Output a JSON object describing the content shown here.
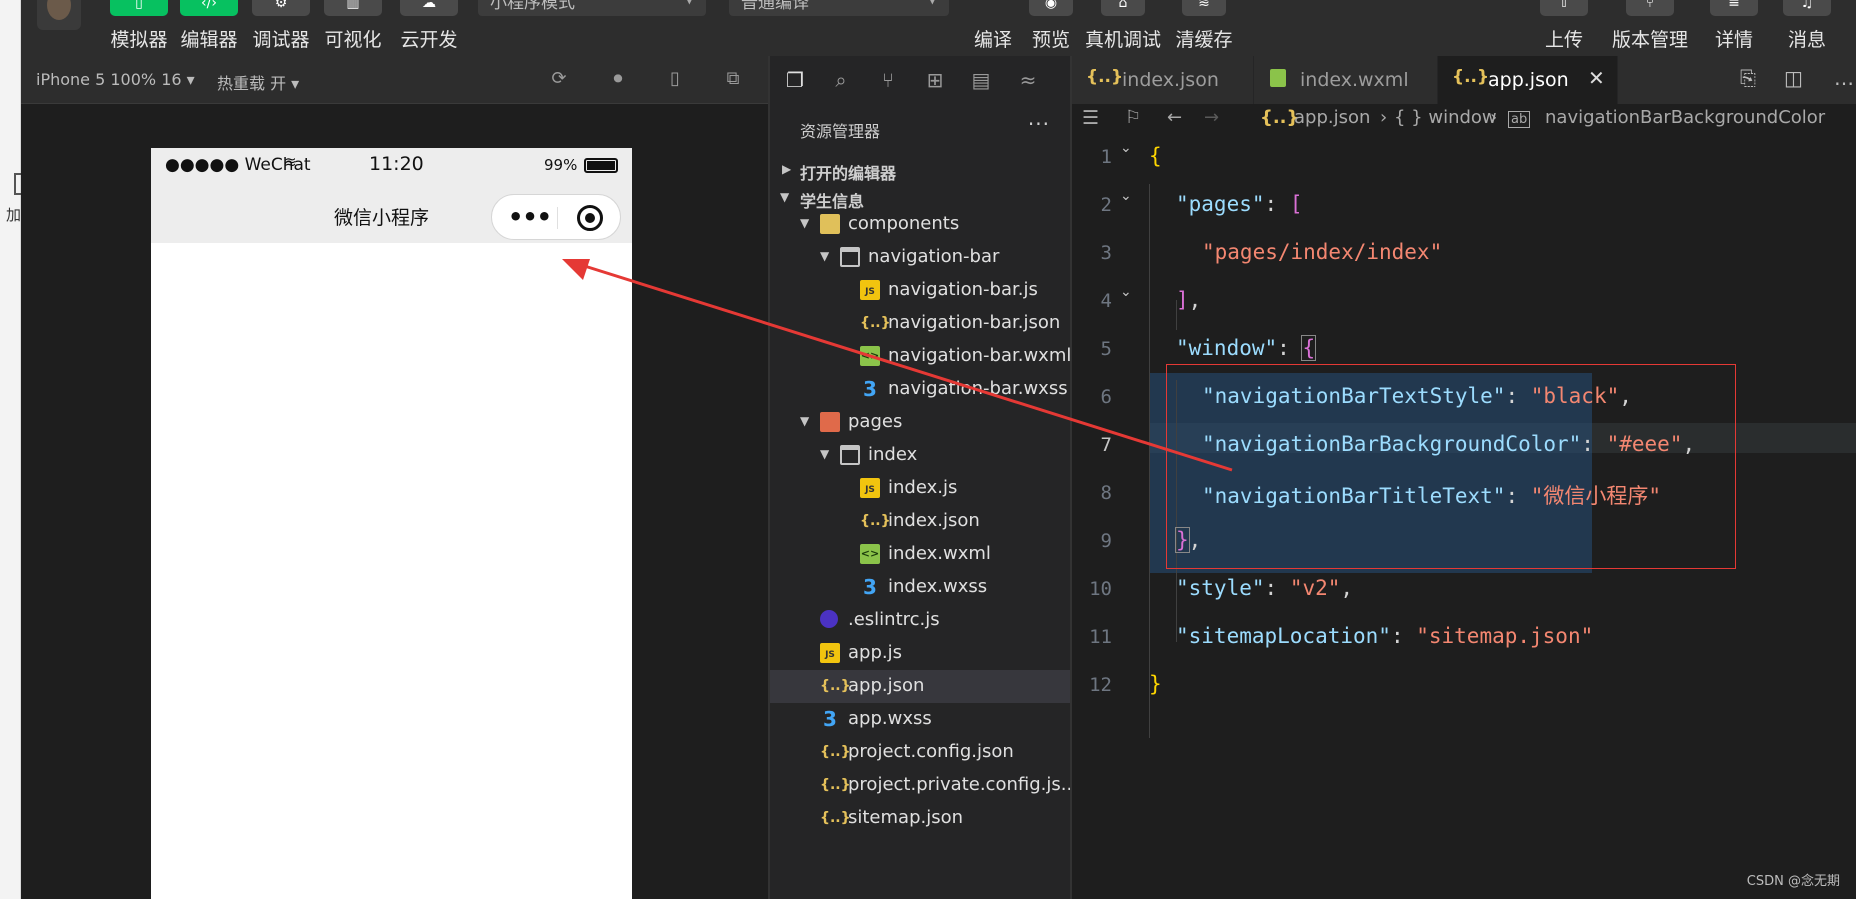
{
  "toolbar": {
    "left_buttons": [
      {
        "label": "模拟器",
        "icon": "phone-icon"
      },
      {
        "label": "编辑器",
        "icon": "code-icon"
      },
      {
        "label": "调试器",
        "icon": "debug-icon"
      },
      {
        "label": "可视化",
        "icon": "layout-icon"
      },
      {
        "label": "云开发",
        "icon": "cloud-icon"
      }
    ],
    "mode_select": "小程序模式",
    "compile_select": "普通编译",
    "mid_buttons": [
      {
        "label": "编译"
      },
      {
        "label": "预览"
      },
      {
        "label": "真机调试"
      },
      {
        "label": "清缓存"
      }
    ],
    "right_buttons": [
      {
        "label": "上传"
      },
      {
        "label": "版本管理"
      },
      {
        "label": "详情"
      },
      {
        "label": "消息"
      }
    ]
  },
  "left_strip": {
    "label": "加"
  },
  "simulator": {
    "device": "iPhone 5 100% 16",
    "hot_reload": "热重载 开",
    "status_bar": {
      "signal": "●●●●● WeChat",
      "time": "11:20",
      "battery": "99%"
    },
    "nav_title": "微信小程序"
  },
  "explorer": {
    "title": "资源管理器",
    "more": "···",
    "open_editors": "打开的编辑器",
    "project": "学生信息",
    "items": [
      {
        "name": "components",
        "type": "folder-comp",
        "indent": 1,
        "twisty": "▼"
      },
      {
        "name": "navigation-bar",
        "type": "folder-open",
        "indent": 2,
        "twisty": "▼"
      },
      {
        "name": "navigation-bar.js",
        "type": "js",
        "indent": 3
      },
      {
        "name": "navigation-bar.json",
        "type": "json",
        "indent": 3
      },
      {
        "name": "navigation-bar.wxml",
        "type": "wxml",
        "indent": 3
      },
      {
        "name": "navigation-bar.wxss",
        "type": "wxss",
        "indent": 3
      },
      {
        "name": "pages",
        "type": "folder-pages",
        "indent": 1,
        "twisty": "▼"
      },
      {
        "name": "index",
        "type": "folder-open",
        "indent": 2,
        "twisty": "▼"
      },
      {
        "name": "index.js",
        "type": "js",
        "indent": 3
      },
      {
        "name": "index.json",
        "type": "json",
        "indent": 3
      },
      {
        "name": "index.wxml",
        "type": "wxml",
        "indent": 3
      },
      {
        "name": "index.wxss",
        "type": "wxss",
        "indent": 3
      },
      {
        "name": ".eslintrc.js",
        "type": "eslint",
        "indent": 1
      },
      {
        "name": "app.js",
        "type": "js",
        "indent": 1
      },
      {
        "name": "app.json",
        "type": "json",
        "indent": 1,
        "selected": true
      },
      {
        "name": "app.wxss",
        "type": "wxss",
        "indent": 1
      },
      {
        "name": "project.config.json",
        "type": "json",
        "indent": 1
      },
      {
        "name": "project.private.config.js...",
        "type": "json",
        "indent": 1
      },
      {
        "name": "sitemap.json",
        "type": "json",
        "indent": 1
      }
    ]
  },
  "editor": {
    "tabs": [
      {
        "label": "index.json",
        "icon": "{..}"
      },
      {
        "label": "index.wxml",
        "icon": "<>"
      },
      {
        "label": "app.json",
        "icon": "{..}",
        "active": true
      }
    ],
    "breadcrumb": [
      "app.json",
      "{ } window",
      "navigationBarBackgroundColor"
    ],
    "line_numbers": [
      "1",
      "2",
      "3",
      "4",
      "5",
      "6",
      "7",
      "8",
      "9",
      "10",
      "11",
      "12"
    ],
    "current_line": "7",
    "code": {
      "l2_key": "\"pages\"",
      "l3_val": "\"pages/index/index\"",
      "l5_key": "\"window\"",
      "l6_key": "\"navigationBarTextStyle\"",
      "l6_val": "\"black\"",
      "l7_key": "\"navigationBarBackgroundColor\"",
      "l7_val": "\"#eee\"",
      "l8_key": "\"navigationBarTitleText\"",
      "l8_val": "\"微信小程序\"",
      "l10_key": "\"style\"",
      "l10_val": "\"v2\"",
      "l11_key": "\"sitemapLocation\"",
      "l11_val": "\"sitemap.json\""
    }
  },
  "watermark": "CSDN @念无期",
  "colors": {
    "accent_green": "#07c160",
    "annotation_red": "#e53935",
    "selection": "#37373d"
  }
}
